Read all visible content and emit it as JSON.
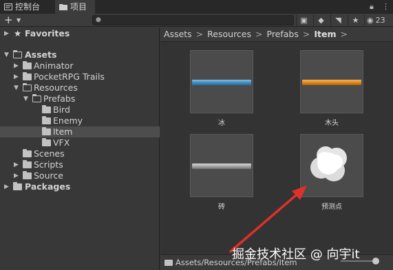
{
  "tabs": [
    {
      "label": "控制台",
      "icon": "console-icon"
    },
    {
      "label": "项目",
      "icon": "folder-icon"
    }
  ],
  "toolbar": {
    "add_label": "+",
    "search_placeholder": "",
    "hidden_count": "23"
  },
  "tree": {
    "favorites": "Favorites",
    "assets": "Assets",
    "items": [
      "Animator",
      "PocketRPG Trails",
      "Resources",
      "Prefabs",
      "Bird",
      "Enemy",
      "Item",
      "VFX",
      "Scenes",
      "Scripts",
      "Source"
    ],
    "packages": "Packages"
  },
  "breadcrumb": [
    "Assets",
    "Resources",
    "Prefabs",
    "Item"
  ],
  "grid": [
    {
      "label": "冰",
      "kind": "bar",
      "color": "#4a8fbf"
    },
    {
      "label": "木头",
      "kind": "bar",
      "color": "#e08a1e"
    },
    {
      "label": "砖",
      "kind": "bar",
      "color": "#9a9a9a"
    },
    {
      "label": "预测点",
      "kind": "cloud",
      "color": "#ffffff"
    }
  ],
  "status_path": "Assets/Resources/Prefabs/Item",
  "watermark": "掘金技术社区 @ 向宇it",
  "colors": {
    "annotation_arrow": "#e0302a",
    "selection": "#4d4d4d"
  }
}
